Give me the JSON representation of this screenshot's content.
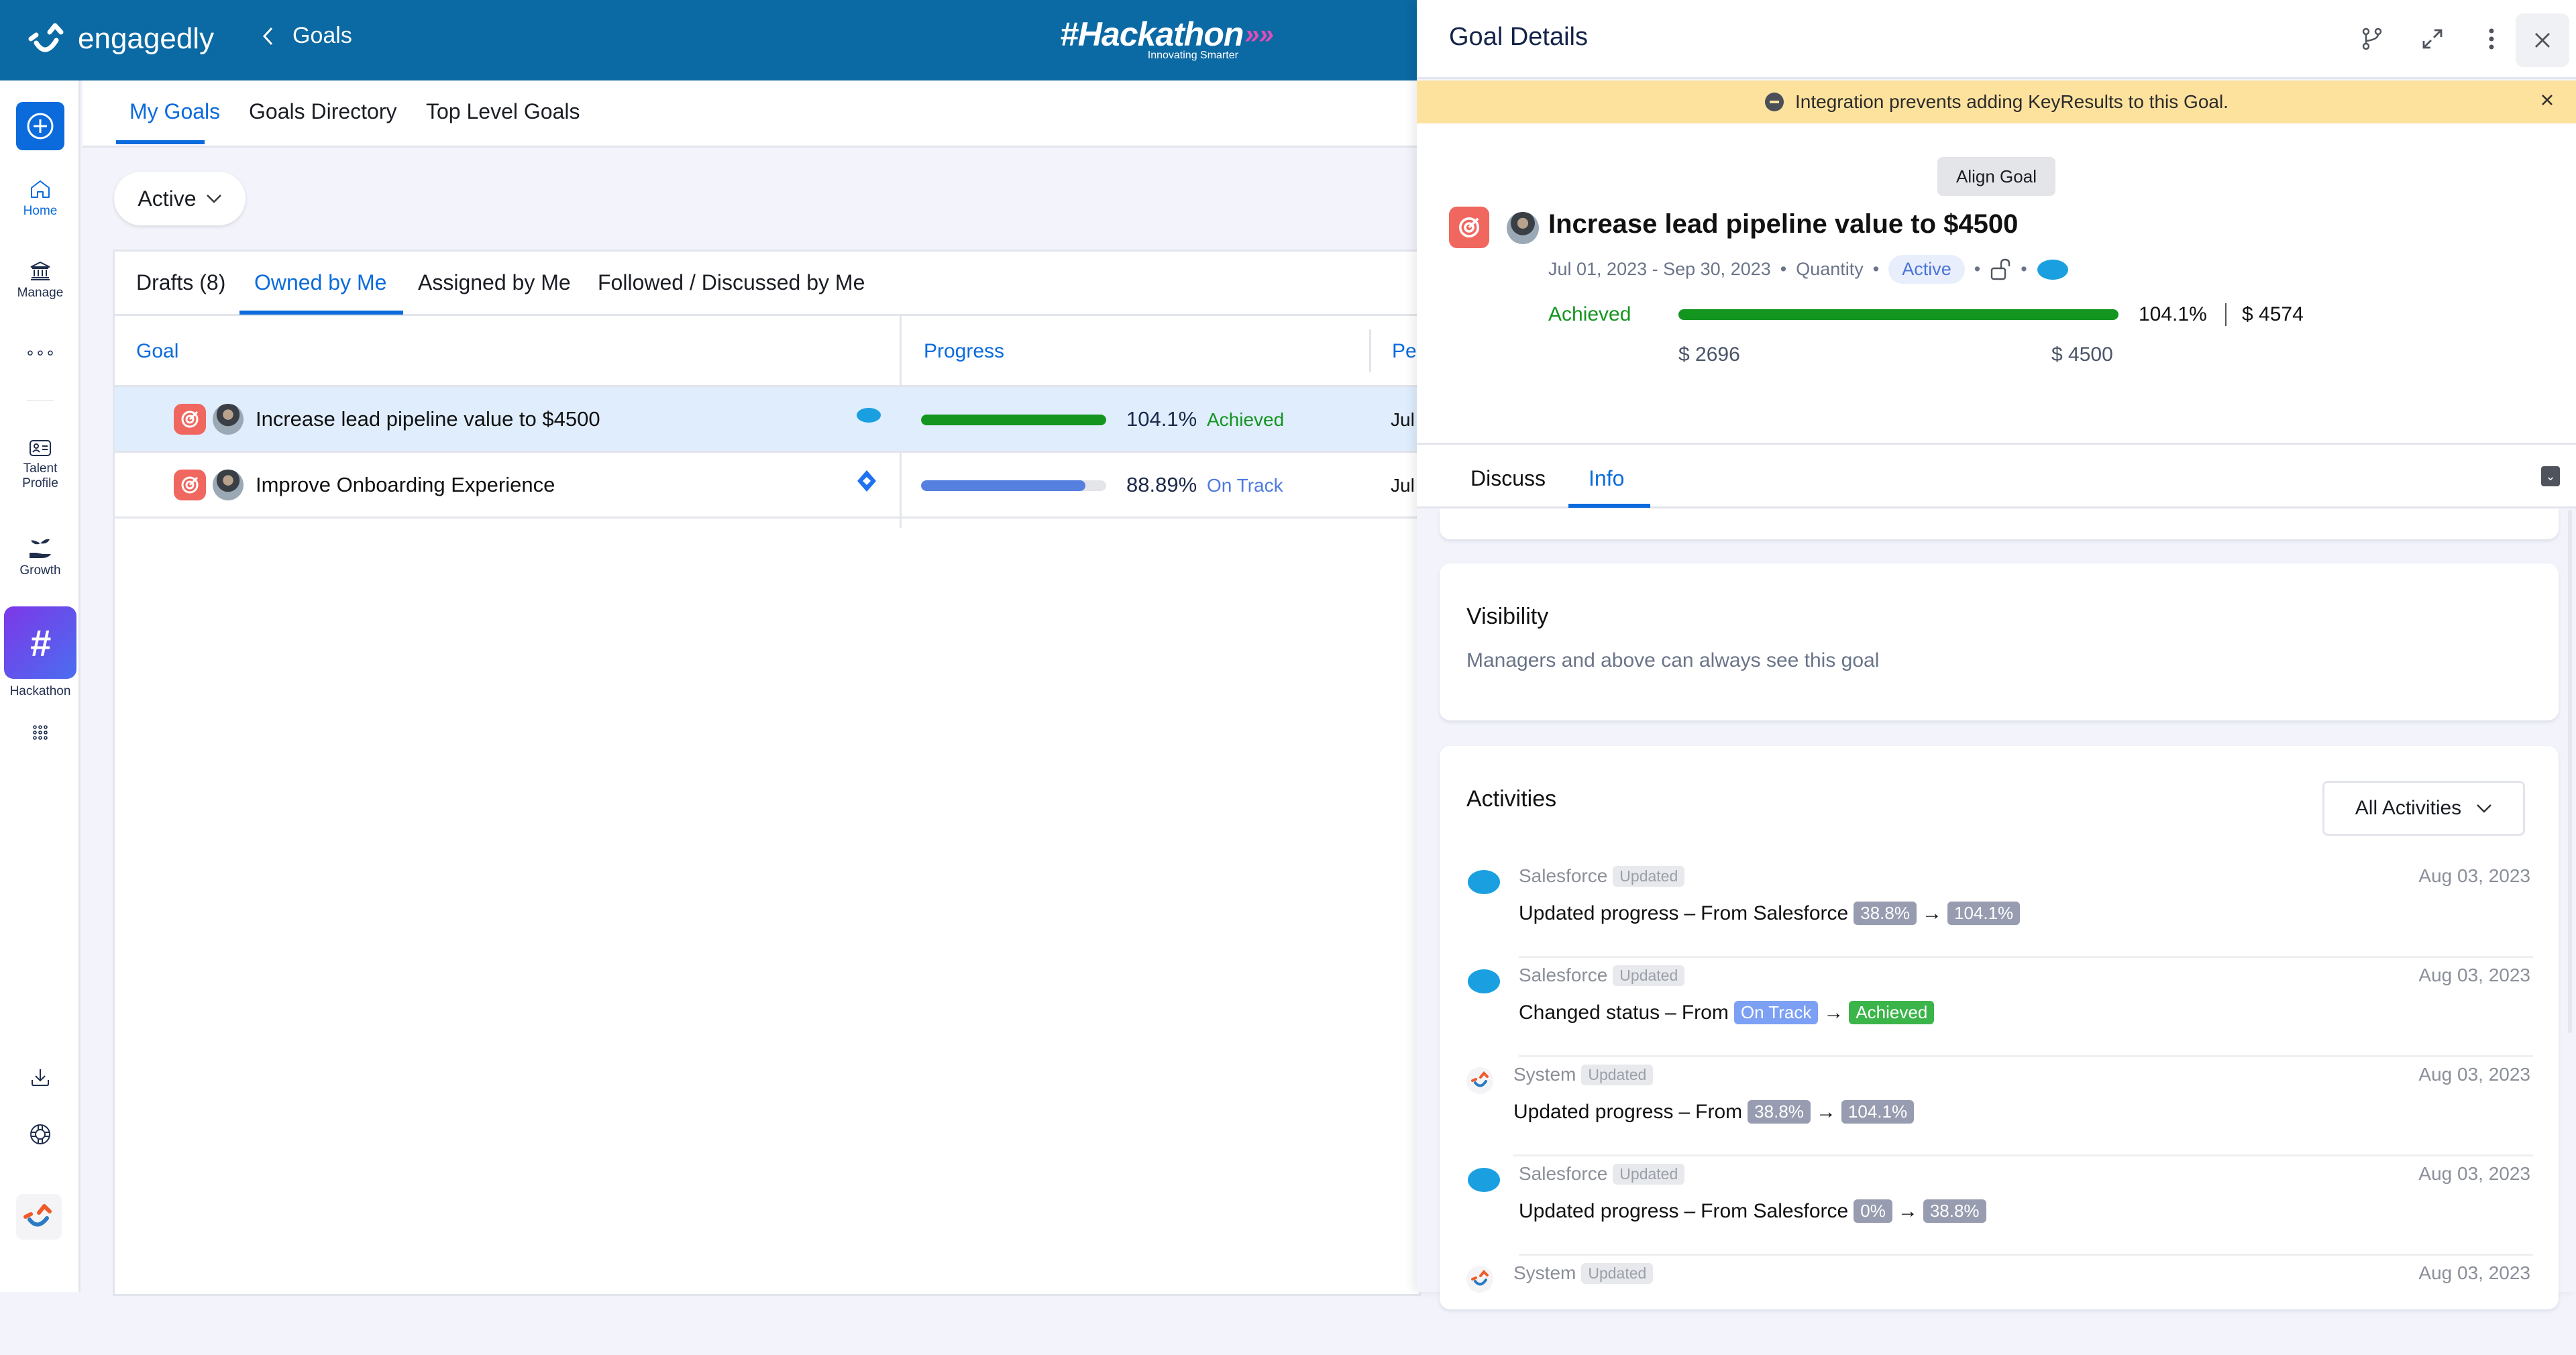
{
  "topbar": {
    "brand": "engagedly",
    "back_label": "Goals",
    "event_logo": {
      "title": "#Hackathon",
      "subtitle": "Innovating Smarter"
    }
  },
  "sidebar": {
    "items": [
      {
        "label": "Home",
        "icon": "home-icon",
        "active": true
      },
      {
        "label": "Manage",
        "icon": "bank-icon"
      },
      {
        "label": "",
        "icon": "more-horizontal-icon"
      },
      {
        "label": "Talent Profile",
        "icon": "id-card-icon"
      },
      {
        "label": "Growth",
        "icon": "plant-hand-icon"
      },
      {
        "label": "Hackathon",
        "icon": "hash-icon"
      },
      {
        "label": "",
        "icon": "apps-grid-icon"
      }
    ],
    "bottom": [
      "download-icon",
      "lifebuoy-icon",
      "system-logo-icon"
    ]
  },
  "main_tabs": [
    {
      "label": "My Goals",
      "active": true
    },
    {
      "label": "Goals Directory"
    },
    {
      "label": "Top Level Goals"
    }
  ],
  "filter": {
    "selected": "Active"
  },
  "sub_tabs": [
    {
      "label": "Drafts (8)"
    },
    {
      "label": "Owned by Me",
      "active": true
    },
    {
      "label": "Assigned by Me"
    },
    {
      "label": "Followed / Discussed by Me"
    }
  ],
  "table": {
    "columns": [
      "Goal",
      "Progress",
      "Pe"
    ],
    "rows": [
      {
        "name": "Increase lead pipeline value to $4500",
        "integration": "salesforce-icon",
        "progress": 104.1,
        "progress_label": "104.1%",
        "status": "Achieved",
        "status_color": "#13951f",
        "bar_color": "#13951f",
        "period": "Jul",
        "selected": true
      },
      {
        "name": "Improve Onboarding Experience",
        "integration": "jira-icon",
        "progress": 88.89,
        "progress_label": "88.89%",
        "status": "On Track",
        "status_color": "#4f7ae0",
        "bar_color": "#5680e0",
        "period": "Jul",
        "selected": false
      }
    ]
  },
  "panel": {
    "title": "Goal Details",
    "banner": "Integration prevents adding KeyResults to this Goal.",
    "align_label": "Align Goal",
    "goal": {
      "title": "Increase lead pipeline value to $4500",
      "dates": "Jul 01, 2023 - Sep 30, 2023",
      "type": "Quantity",
      "state": "Active",
      "status": "Achieved",
      "progress": 104.1,
      "progress_label": "104.1%",
      "current": "$ 4574",
      "start": "$ 2696",
      "target": "$ 4500"
    },
    "tabs": [
      {
        "label": "Discuss"
      },
      {
        "label": "Info",
        "active": true
      }
    ],
    "visibility": {
      "title": "Visibility",
      "text": "Managers and above can always see this goal"
    },
    "activities": {
      "title": "Activities",
      "filter": "All Activities",
      "items": [
        {
          "source": "Salesforce",
          "tag": "Updated",
          "date": "Aug 03, 2023",
          "action": "Updated progress",
          "dash": "–",
          "from_label": "From Salesforce",
          "from": "38.8%",
          "to": "104.1%",
          "kind": "progress"
        },
        {
          "source": "Salesforce",
          "tag": "Updated",
          "date": "Aug 03, 2023",
          "action": "Changed status",
          "dash": "–",
          "from_label": "From",
          "from": "On Track",
          "to": "Achieved",
          "kind": "status"
        },
        {
          "source": "System",
          "tag": "Updated",
          "date": "Aug 03, 2023",
          "action": "Updated progress",
          "dash": "–",
          "from_label": "From",
          "from": "38.8%",
          "to": "104.1%",
          "kind": "progress"
        },
        {
          "source": "Salesforce",
          "tag": "Updated",
          "date": "Aug 03, 2023",
          "action": "Updated progress",
          "dash": "–",
          "from_label": "From Salesforce",
          "from": "0%",
          "to": "38.8%",
          "kind": "progress"
        },
        {
          "source": "System",
          "tag": "Updated",
          "date": "Aug 03, 2023"
        }
      ]
    }
  }
}
